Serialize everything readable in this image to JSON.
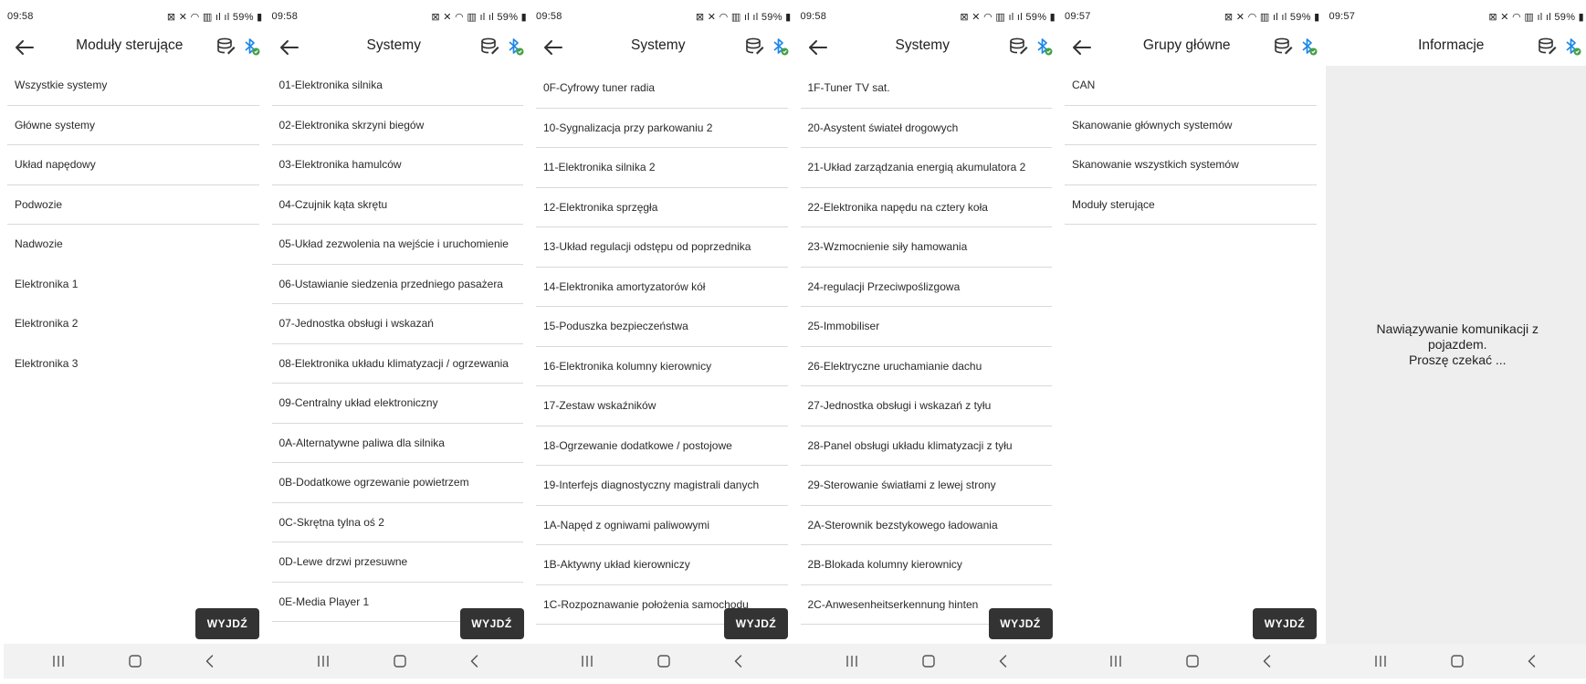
{
  "status": {
    "battery": "59%"
  },
  "exit_label": "WYJDŹ",
  "screens": [
    {
      "time": "09:58",
      "title": "Moduły sterujące",
      "items": [
        "Wszystkie systemy",
        "Główne systemy",
        "Układ napędowy",
        "Podwozie",
        "Nadwozie",
        "Elektronika 1",
        "Elektronika 2",
        "Elektronika 3"
      ]
    },
    {
      "time": "09:58",
      "title": "Systemy",
      "items": [
        "01-Elektronika silnika",
        "02-Elektronika skrzyni biegów",
        "03-Elektronika hamulców",
        "04-Czujnik kąta skrętu",
        "05-Układ zezwolenia na wejście i uruchomienie",
        "06-Ustawianie siedzenia przedniego pasażera",
        "07-Jednostka obsługi i wskazań",
        "08-Elektronika układu klimatyzacji / ogrzewania",
        "09-Centralny układ elektroniczny",
        "0A-Alternatywne paliwa dla silnika",
        "0B-Dodatkowe ogrzewanie powietrzem",
        "0C-Skrętna tylna oś 2",
        "0D-Lewe drzwi przesuwne",
        "0E-Media Player 1"
      ]
    },
    {
      "time": "09:58",
      "title": "Systemy",
      "items": [
        "0F-Cyfrowy tuner radia",
        "10-Sygnalizacja przy parkowaniu 2",
        "11-Elektronika silnika 2",
        "12-Elektronika sprzęgła",
        "13-Układ regulacji odstępu od poprzednika",
        "14-Elektronika amortyzatorów kół",
        "15-Poduszka bezpieczeństwa",
        "16-Elektronika kolumny kierownicy",
        "17-Zestaw wskaźników",
        "18-Ogrzewanie dodatkowe / postojowe",
        "19-Interfejs diagnostyczny magistrali danych",
        "1A-Napęd z ogniwami paliwowymi",
        "1B-Aktywny układ kierowniczy",
        "1C-Rozpoznawanie położenia samochodu"
      ]
    },
    {
      "time": "09:58",
      "title": "Systemy",
      "items": [
        "1F-Tuner TV sat.",
        "20-Asystent świateł drogowych",
        "21-Układ zarządzania energią akumulatora 2",
        "22-Elektronika napędu na cztery koła",
        "23-Wzmocnienie siły hamowania",
        "24-regulacji Przeciwpoślizgowa",
        "25-Immobiliser",
        "26-Elektryczne uruchamianie dachu",
        "27-Jednostka obsługi i wskazań z tyłu",
        "28-Panel obsługi układu klimatyzacji z tyłu",
        "29-Sterowanie światłami z lewej strony",
        "2A-Sterownik bezstykowego ładowania",
        "2B-Blokada kolumny kierownicy",
        "2C-Anwesenheitserkennung hinten"
      ]
    },
    {
      "time": "09:57",
      "title": "Grupy główne",
      "items": [
        "CAN",
        "Skanowanie głównych systemów",
        "Skanowanie wszystkich systemów",
        "Moduły sterujące"
      ]
    },
    {
      "time": "09:57",
      "title": "Informacje",
      "message": [
        "Nawiązywanie komunikacji z",
        "pojazdem.",
        "Proszę czekać ..."
      ]
    }
  ]
}
